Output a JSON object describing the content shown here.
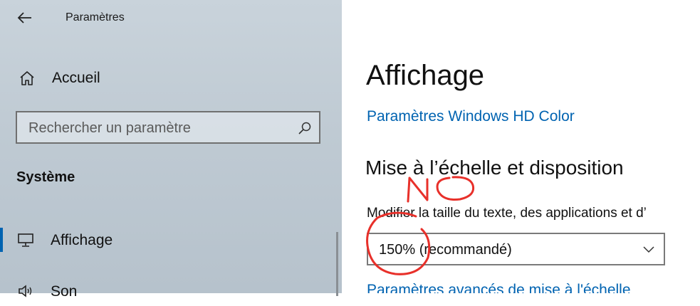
{
  "window": {
    "title": "Paramètres"
  },
  "sidebar": {
    "home_label": "Accueil",
    "search_placeholder": "Rechercher un paramètre",
    "section_title": "Système",
    "items": [
      {
        "label": "Affichage",
        "icon": "monitor-icon",
        "selected": true
      },
      {
        "label": "Son",
        "icon": "speaker-icon",
        "selected": false
      }
    ]
  },
  "main": {
    "page_title": "Affichage",
    "hd_color_link": "Paramètres Windows HD Color",
    "scale_section_heading": "Mise à l’échelle et disposition",
    "scale_label": "Modifier la taille du texte, des applications et d’",
    "scale_select_value": "150% (recommandé)",
    "advanced_scale_link": "Paramètres avancés de mise à l'échelle"
  },
  "annotation": {
    "text": "NO",
    "color": "#e8302a"
  },
  "colors": {
    "accent": "#0063b1",
    "sidebar_bg": "#c4ced7"
  }
}
